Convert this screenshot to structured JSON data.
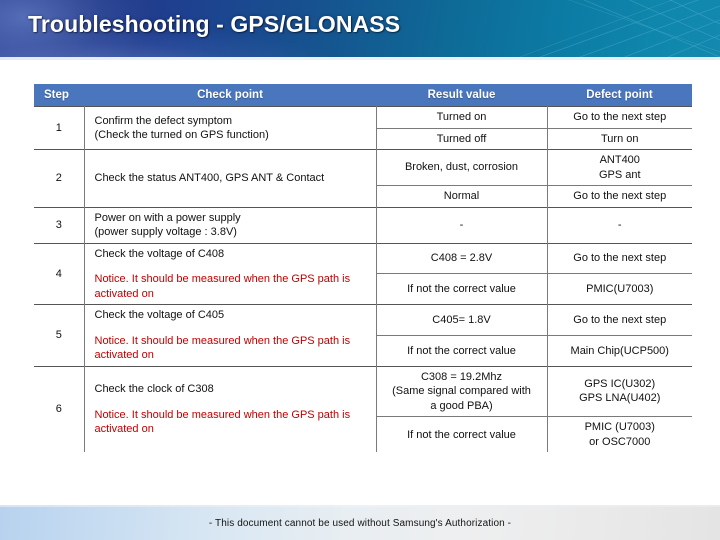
{
  "slide": {
    "title": "Troubleshooting - GPS/GLONASS",
    "footer": "- This document cannot be used without Samsung's Authorization -",
    "accent_banner_left": "#2b3d8c",
    "accent_banner_right": "#1389ae",
    "table_header_color": "#4a76be",
    "notice_color": "#c00000"
  },
  "table": {
    "headers": {
      "step": "Step",
      "check_point": "Check point",
      "result_value": "Result value",
      "defect_point": "Defect point"
    },
    "rows": [
      {
        "step": "1",
        "check_point": {
          "lines": [
            "Confirm the defect symptom",
            "(Check the turned on GPS function)"
          ],
          "notice": null
        },
        "outcomes": [
          {
            "result": "Turned on",
            "defect": "Go to the next step"
          },
          {
            "result": "Turned off",
            "defect": "Turn on"
          }
        ]
      },
      {
        "step": "2",
        "check_point": {
          "lines": [
            "Check the status ANT400, GPS ANT & Contact"
          ],
          "notice": null
        },
        "outcomes": [
          {
            "result": "Broken, dust, corrosion",
            "defect": "ANT400\nGPS ant"
          },
          {
            "result": "Normal",
            "defect": "Go to the next step"
          }
        ]
      },
      {
        "step": "3",
        "check_point": {
          "lines": [
            "Power on with a power supply",
            "(power supply voltage : 3.8V)"
          ],
          "notice": null
        },
        "outcomes": [
          {
            "result": "-",
            "defect": "-"
          }
        ]
      },
      {
        "step": "4",
        "check_point": {
          "lines": [
            "Check the voltage of C408"
          ],
          "notice": "Notice. It should be measured when the GPS path is activated on"
        },
        "outcomes": [
          {
            "result": "C408 = 2.8V",
            "defect": "Go to the next step"
          },
          {
            "result": "If not the correct value",
            "defect": "PMIC(U7003)"
          }
        ]
      },
      {
        "step": "5",
        "check_point": {
          "lines": [
            "Check the voltage of C405"
          ],
          "notice": "Notice. It should be measured when the GPS path is activated on"
        },
        "outcomes": [
          {
            "result": "C405= 1.8V",
            "defect": "Go to the next step"
          },
          {
            "result": "If not the correct value",
            "defect": "Main Chip(UCP500)"
          }
        ]
      },
      {
        "step": "6",
        "check_point": {
          "lines": [
            "Check the clock of C308"
          ],
          "notice": "Notice. It should be measured when the GPS path is activated on"
        },
        "outcomes": [
          {
            "result": "C308 = 19.2Mhz\n(Same signal compared with\na good PBA)",
            "defect": "GPS IC(U302)\nGPS LNA(U402)"
          },
          {
            "result": "If not the correct value",
            "defect": "PMIC (U7003)\nor OSC7000"
          }
        ]
      }
    ]
  }
}
